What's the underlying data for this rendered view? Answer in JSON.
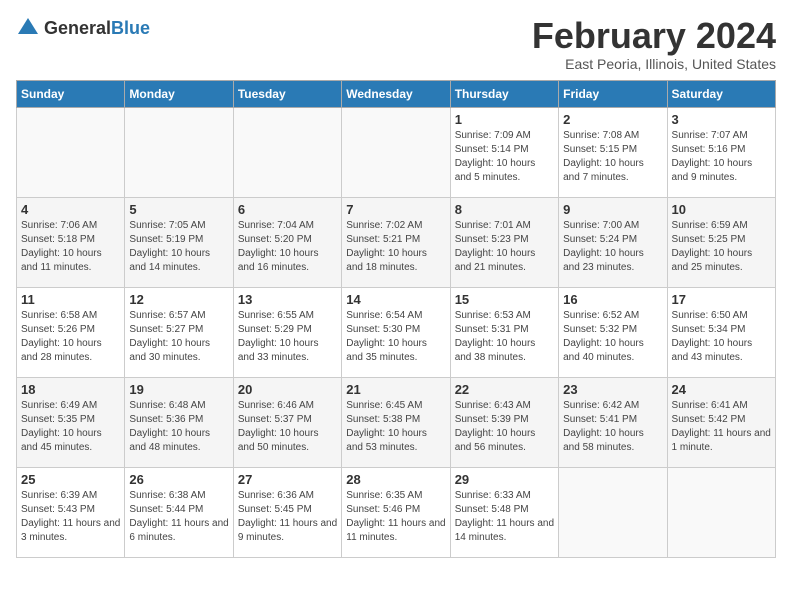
{
  "header": {
    "logo_general": "General",
    "logo_blue": "Blue",
    "month_title": "February 2024",
    "location": "East Peoria, Illinois, United States"
  },
  "weekdays": [
    "Sunday",
    "Monday",
    "Tuesday",
    "Wednesday",
    "Thursday",
    "Friday",
    "Saturday"
  ],
  "weeks": [
    [
      {
        "day": "",
        "info": ""
      },
      {
        "day": "",
        "info": ""
      },
      {
        "day": "",
        "info": ""
      },
      {
        "day": "",
        "info": ""
      },
      {
        "day": "1",
        "info": "Sunrise: 7:09 AM\nSunset: 5:14 PM\nDaylight: 10 hours\nand 5 minutes."
      },
      {
        "day": "2",
        "info": "Sunrise: 7:08 AM\nSunset: 5:15 PM\nDaylight: 10 hours\nand 7 minutes."
      },
      {
        "day": "3",
        "info": "Sunrise: 7:07 AM\nSunset: 5:16 PM\nDaylight: 10 hours\nand 9 minutes."
      }
    ],
    [
      {
        "day": "4",
        "info": "Sunrise: 7:06 AM\nSunset: 5:18 PM\nDaylight: 10 hours\nand 11 minutes."
      },
      {
        "day": "5",
        "info": "Sunrise: 7:05 AM\nSunset: 5:19 PM\nDaylight: 10 hours\nand 14 minutes."
      },
      {
        "day": "6",
        "info": "Sunrise: 7:04 AM\nSunset: 5:20 PM\nDaylight: 10 hours\nand 16 minutes."
      },
      {
        "day": "7",
        "info": "Sunrise: 7:02 AM\nSunset: 5:21 PM\nDaylight: 10 hours\nand 18 minutes."
      },
      {
        "day": "8",
        "info": "Sunrise: 7:01 AM\nSunset: 5:23 PM\nDaylight: 10 hours\nand 21 minutes."
      },
      {
        "day": "9",
        "info": "Sunrise: 7:00 AM\nSunset: 5:24 PM\nDaylight: 10 hours\nand 23 minutes."
      },
      {
        "day": "10",
        "info": "Sunrise: 6:59 AM\nSunset: 5:25 PM\nDaylight: 10 hours\nand 25 minutes."
      }
    ],
    [
      {
        "day": "11",
        "info": "Sunrise: 6:58 AM\nSunset: 5:26 PM\nDaylight: 10 hours\nand 28 minutes."
      },
      {
        "day": "12",
        "info": "Sunrise: 6:57 AM\nSunset: 5:27 PM\nDaylight: 10 hours\nand 30 minutes."
      },
      {
        "day": "13",
        "info": "Sunrise: 6:55 AM\nSunset: 5:29 PM\nDaylight: 10 hours\nand 33 minutes."
      },
      {
        "day": "14",
        "info": "Sunrise: 6:54 AM\nSunset: 5:30 PM\nDaylight: 10 hours\nand 35 minutes."
      },
      {
        "day": "15",
        "info": "Sunrise: 6:53 AM\nSunset: 5:31 PM\nDaylight: 10 hours\nand 38 minutes."
      },
      {
        "day": "16",
        "info": "Sunrise: 6:52 AM\nSunset: 5:32 PM\nDaylight: 10 hours\nand 40 minutes."
      },
      {
        "day": "17",
        "info": "Sunrise: 6:50 AM\nSunset: 5:34 PM\nDaylight: 10 hours\nand 43 minutes."
      }
    ],
    [
      {
        "day": "18",
        "info": "Sunrise: 6:49 AM\nSunset: 5:35 PM\nDaylight: 10 hours\nand 45 minutes."
      },
      {
        "day": "19",
        "info": "Sunrise: 6:48 AM\nSunset: 5:36 PM\nDaylight: 10 hours\nand 48 minutes."
      },
      {
        "day": "20",
        "info": "Sunrise: 6:46 AM\nSunset: 5:37 PM\nDaylight: 10 hours\nand 50 minutes."
      },
      {
        "day": "21",
        "info": "Sunrise: 6:45 AM\nSunset: 5:38 PM\nDaylight: 10 hours\nand 53 minutes."
      },
      {
        "day": "22",
        "info": "Sunrise: 6:43 AM\nSunset: 5:39 PM\nDaylight: 10 hours\nand 56 minutes."
      },
      {
        "day": "23",
        "info": "Sunrise: 6:42 AM\nSunset: 5:41 PM\nDaylight: 10 hours\nand 58 minutes."
      },
      {
        "day": "24",
        "info": "Sunrise: 6:41 AM\nSunset: 5:42 PM\nDaylight: 11 hours\nand 1 minute."
      }
    ],
    [
      {
        "day": "25",
        "info": "Sunrise: 6:39 AM\nSunset: 5:43 PM\nDaylight: 11 hours\nand 3 minutes."
      },
      {
        "day": "26",
        "info": "Sunrise: 6:38 AM\nSunset: 5:44 PM\nDaylight: 11 hours\nand 6 minutes."
      },
      {
        "day": "27",
        "info": "Sunrise: 6:36 AM\nSunset: 5:45 PM\nDaylight: 11 hours\nand 9 minutes."
      },
      {
        "day": "28",
        "info": "Sunrise: 6:35 AM\nSunset: 5:46 PM\nDaylight: 11 hours\nand 11 minutes."
      },
      {
        "day": "29",
        "info": "Sunrise: 6:33 AM\nSunset: 5:48 PM\nDaylight: 11 hours\nand 14 minutes."
      },
      {
        "day": "",
        "info": ""
      },
      {
        "day": "",
        "info": ""
      }
    ]
  ]
}
